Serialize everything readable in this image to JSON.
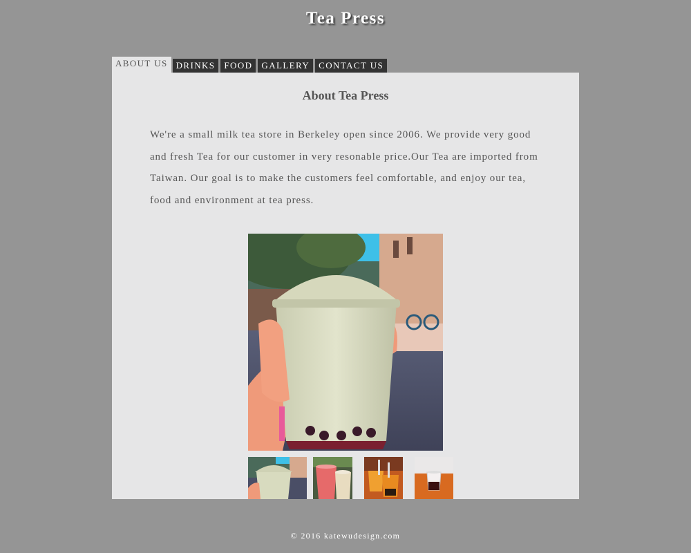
{
  "header": {
    "title": "Tea Press"
  },
  "nav": {
    "tabs": [
      {
        "label": "ABOUT US",
        "active": true
      },
      {
        "label": "DRINKS",
        "active": false
      },
      {
        "label": "FOOD",
        "active": false
      },
      {
        "label": "GALLERY",
        "active": false
      },
      {
        "label": "CONTACT US",
        "active": false
      }
    ]
  },
  "main": {
    "heading": "About Tea Press",
    "intro": "We're a small milk tea store in Berkeley open since 2006. We provide very good and fresh Tea for our customer in very resonable price.Our Tea are imported from Taiwan. Our goal is to make the customers feel comfortable, and enjoy our tea, food and environment at tea press."
  },
  "gallery": {
    "main_photo": "milk tea with boba held in hand",
    "thumbnails": [
      "milk tea cup thumbnail",
      "strawberry drinks thumbnail",
      "orange drinks thumbnail",
      "red tea cup thumbnail"
    ]
  },
  "colors": {
    "page_background": "#959595",
    "panel_background": "#e6e6e7",
    "tab_background": "#333333",
    "text": "#555555"
  },
  "footer": {
    "text": "©  2016  katewudesign.com"
  }
}
